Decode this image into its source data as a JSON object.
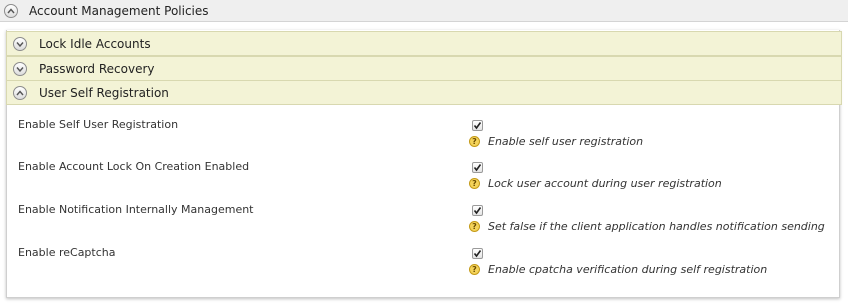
{
  "page": {
    "section_title": "Account Management Policies"
  },
  "accordion": {
    "headers": [
      {
        "label": "Lock Idle Accounts",
        "state": "collapsed"
      },
      {
        "label": "Password Recovery",
        "state": "collapsed"
      },
      {
        "label": "User Self Registration",
        "state": "expanded"
      }
    ]
  },
  "settings": [
    {
      "label": "Enable Self User Registration",
      "checked": true,
      "help": "Enable self user registration"
    },
    {
      "label": "Enable Account Lock On Creation Enabled",
      "checked": true,
      "help": "Lock user account during user registration"
    },
    {
      "label": "Enable Notification Internally Management",
      "checked": true,
      "help": "Set false if the client application handles notification sending"
    },
    {
      "label": "Enable reCaptcha",
      "checked": true,
      "help": "Enable cpatcha verification during self registration"
    }
  ],
  "icons": {
    "expanded": "chevron-up-icon",
    "collapsed": "chevron-down-icon",
    "help": "help-icon",
    "check": "checkmark-icon"
  },
  "colors": {
    "accordion_header_bg": "#f3f3d6",
    "section_header_bg": "#efefef",
    "help_icon": "#f4d35a"
  }
}
